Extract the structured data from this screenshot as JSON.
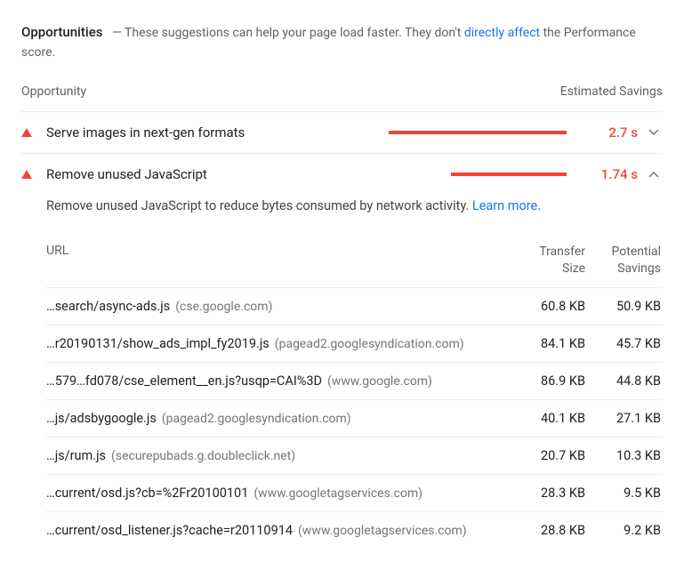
{
  "header": {
    "title": "Opportunities",
    "dash": "—",
    "text_prefix": "These suggestions can help your page load faster. They don't ",
    "link": "directly affect",
    "text_suffix": " the Performance score."
  },
  "columns": {
    "left": "Opportunity",
    "right": "Estimated Savings"
  },
  "opportunities": [
    {
      "title": "Serve images in next-gen formats",
      "savings": "2.7 s",
      "bar_percent": 100,
      "expanded": false
    },
    {
      "title": "Remove unused JavaScript",
      "savings": "1.74 s",
      "bar_percent": 65,
      "expanded": true,
      "description": "Remove unused JavaScript to reduce bytes consumed by network activity. ",
      "learn_more": "Learn more",
      "table": {
        "headers": {
          "url": "URL",
          "transfer1": "Transfer",
          "transfer2": "Size",
          "savings1": "Potential",
          "savings2": "Savings"
        },
        "rows": [
          {
            "path": "…search/async-ads.js",
            "host": "(cse.google.com)",
            "transfer": "60.8 KB",
            "savings": "50.9 KB"
          },
          {
            "path": "…r20190131/show_ads_impl_fy2019.js",
            "host": "(pagead2.googlesyndication.com)",
            "transfer": "84.1 KB",
            "savings": "45.7 KB"
          },
          {
            "path": "…579…fd078/cse_element__en.js?usqp=CAI%3D",
            "host": "(www.google.com)",
            "transfer": "86.9 KB",
            "savings": "44.8 KB"
          },
          {
            "path": "…js/adsbygoogle.js",
            "host": "(pagead2.googlesyndication.com)",
            "transfer": "40.1 KB",
            "savings": "27.1 KB"
          },
          {
            "path": "…js/rum.js",
            "host": "(securepubads.g.doubleclick.net)",
            "transfer": "20.7 KB",
            "savings": "10.3 KB"
          },
          {
            "path": "…current/osd.js?cb=%2Fr20100101",
            "host": "(www.googletagservices.com)",
            "transfer": "28.3 KB",
            "savings": "9.5 KB"
          },
          {
            "path": "…current/osd_listener.js?cache=r20110914",
            "host": "(www.googletagservices.com)",
            "transfer": "28.8 KB",
            "savings": "9.2 KB"
          }
        ]
      }
    }
  ]
}
